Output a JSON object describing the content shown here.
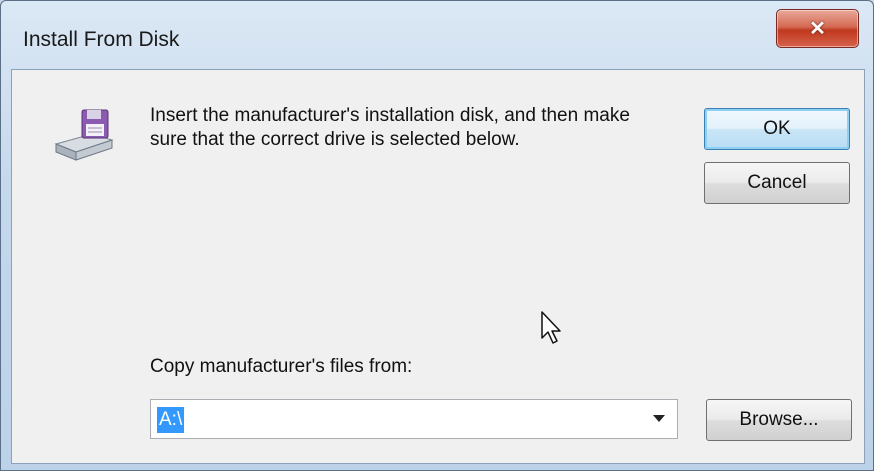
{
  "window": {
    "title": "Install From Disk",
    "close_glyph": "✕"
  },
  "dialog": {
    "message": "Insert the manufacturer's installation disk, and then make sure that the correct drive is selected below.",
    "ok_label": "OK",
    "cancel_label": "Cancel",
    "copy_label": "Copy manufacturer's files from:",
    "path_value": "A:\\",
    "browse_label": "Browse...",
    "icon": "floppy-disk-drive-icon",
    "dropdown_icon": "chevron-down-icon"
  },
  "colors": {
    "selection": "#3399ff",
    "close_button": "#c0391f",
    "ok_border": "#3c7fb1"
  }
}
